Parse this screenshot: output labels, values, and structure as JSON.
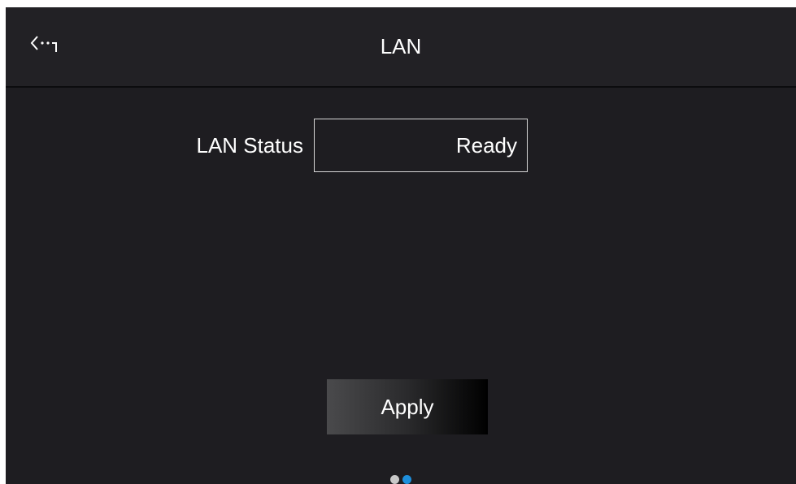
{
  "header": {
    "title": "LAN",
    "back_icon": "back-icon"
  },
  "fields": [
    {
      "label": "LAN Status",
      "value": "Ready"
    }
  ],
  "apply_label": "Apply",
  "pager": {
    "current_page": 2,
    "total_pages": 2
  },
  "colors": {
    "background": "#1e1d21",
    "header_background": "#222125",
    "text": "#ffffff",
    "dot_inactive": "#c8c8c8",
    "dot_active": "#1e8fdc"
  }
}
